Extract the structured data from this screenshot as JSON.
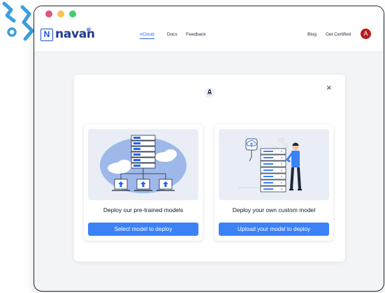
{
  "window": {
    "traffic_lights": [
      "#e0567a",
      "#f5c451",
      "#3fcf6e"
    ]
  },
  "nav": {
    "logo_mark": "N",
    "logo_text": "navan",
    "logo_superscript": "ai",
    "links": [
      {
        "label": "nCloud",
        "active": true
      },
      {
        "label": "Docs",
        "active": false
      },
      {
        "label": "Feedback",
        "active": false
      }
    ],
    "right_links": [
      {
        "label": "Blog"
      },
      {
        "label": "Get Certified"
      }
    ],
    "avatar_initial": "A",
    "accent_color": "#2563eb"
  },
  "modal": {
    "header_icon": "rocket-icon",
    "close_label": "×",
    "cards": [
      {
        "title": "Deploy our pre-trained models",
        "button": "Select model to deploy",
        "illustration": "servers-cloud-illustration"
      },
      {
        "title": "Deploy your own custom model",
        "button": "Upload your model to deploy",
        "illustration": "person-server-rack-illustration"
      }
    ],
    "button_color": "#3b82f6"
  }
}
